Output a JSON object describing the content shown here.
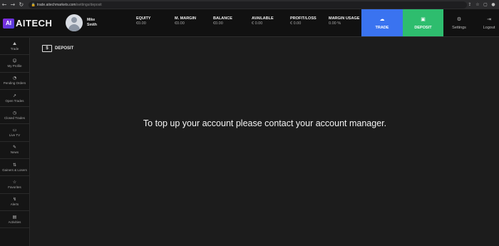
{
  "browser": {
    "url_host": "trade.aitechmarkets.com",
    "url_path": "/settings/deposit"
  },
  "header": {
    "logo_badge": "AI",
    "logo_text": "AITECH",
    "user_first": "Mike",
    "user_last": "Smith",
    "stats": [
      {
        "label": "EQUITY",
        "value": "€0.00"
      },
      {
        "label": "M. MARGIN",
        "value": "€0.00"
      },
      {
        "label": "BALANCE",
        "value": "€0.00"
      },
      {
        "label": "AVAILABLE",
        "value": "€ 0.00"
      },
      {
        "label": "PROFIT/LOSS",
        "value": "€ 0.00"
      },
      {
        "label": "MARGIN USAGE",
        "value": "0.00 %"
      }
    ],
    "trade_label": "TRADE",
    "deposit_label": "DEPOSIT",
    "settings_label": "Settings",
    "logout_label": "Logout",
    "colors": {
      "trade": "#3a73f0",
      "deposit": "#2ebd6e"
    }
  },
  "sidebar": {
    "items": [
      {
        "label": "Trade",
        "icon": "chart-icon"
      },
      {
        "label": "My Profile",
        "icon": "profile-icon"
      },
      {
        "label": "Pending Orders",
        "icon": "pending-icon"
      },
      {
        "label": "Open Trades",
        "icon": "open-trades-icon"
      },
      {
        "label": "Closed Trades",
        "icon": "closed-trades-icon"
      },
      {
        "label": "Live TV",
        "icon": "tv-icon"
      },
      {
        "label": "News",
        "icon": "news-icon"
      },
      {
        "label": "Gainers & Losers",
        "icon": "gainers-icon"
      },
      {
        "label": "Favorites",
        "icon": "star-icon"
      },
      {
        "label": "Alerts",
        "icon": "alerts-icon"
      },
      {
        "label": "Activities",
        "icon": "activities-icon"
      }
    ]
  },
  "main": {
    "title": "DEPOSIT",
    "message": "To top up your account please contact your account manager."
  }
}
